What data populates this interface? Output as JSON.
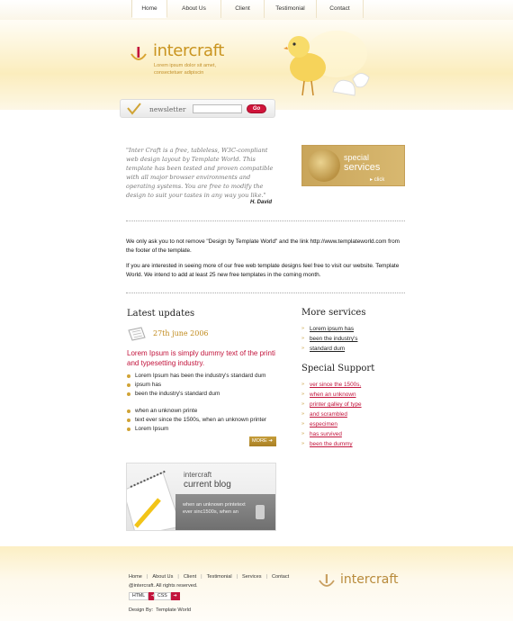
{
  "nav": [
    "Home",
    "About Us",
    "Client",
    "Testimonial",
    "Contact"
  ],
  "brand": {
    "name": "intercraft",
    "tagline": "Lorem ipsum dolor sit amet, consectetuer adipiscin"
  },
  "newsletter": {
    "label": "newsletter",
    "value": "",
    "go": "Go"
  },
  "quote": {
    "text": "\"Inter Craft is a free, tableless, W3C-compliant web design layout by Template World. This template has been tested and proven compatible with all major browser environments and operating systems. You are free to modify the design to suit your tastes in any way you like.\"",
    "author": "H. David"
  },
  "special": {
    "line1": "special",
    "line2": "services",
    "cta": "click"
  },
  "intro": {
    "p1": "We only ask you to not remove \"Design by Template World\" and the link http://www.templateworld.com from the footer of the template.",
    "p2": "If you are interested in seeing more of our free web template designs feel free to visit our website. Template World. We intend to add at least 25 new free templates in the coming month."
  },
  "latest": {
    "title": "Latest updates",
    "date": "27th june 2006",
    "headline": "Lorem Ipsum is simply dummy text of the printi and typesetting industry.",
    "list1": [
      "Lorem Ipsum has been the industry's standard dum",
      "ipsum has",
      "been the industry's standard dum"
    ],
    "list2": [
      "when an unknown printe",
      "text ever since the 1500s, when an unknown printer",
      "Lorem Ipsum"
    ],
    "more": "MORE"
  },
  "blog": {
    "line1": "intercraft",
    "line2": "current blog",
    "text": "when an unknown printetext ever sinc1500s, when an"
  },
  "more_services": {
    "title": "More services",
    "items": [
      "Lorem ipsum has",
      "been the industry's",
      "standard dum"
    ]
  },
  "special_support": {
    "title": "Special Support",
    "items": [
      "ver since the 1500s,",
      "when an unknown",
      "printer galley of type",
      "and scrambled",
      "especimen",
      "has survived",
      "been the dummy"
    ]
  },
  "footer": {
    "links": [
      "Home",
      "About Us",
      "Client",
      "Testimonial",
      "Services",
      "Contact"
    ],
    "copyright": "@intercraft. All rights reserved.",
    "badges": [
      "HTML",
      "CSS"
    ],
    "design_label": "Design By:",
    "design_by": "Template World",
    "logo": "intercraft"
  },
  "colors": {
    "accent": "#c9941f",
    "pink": "#c2143c",
    "cream": "#fbedbd"
  }
}
